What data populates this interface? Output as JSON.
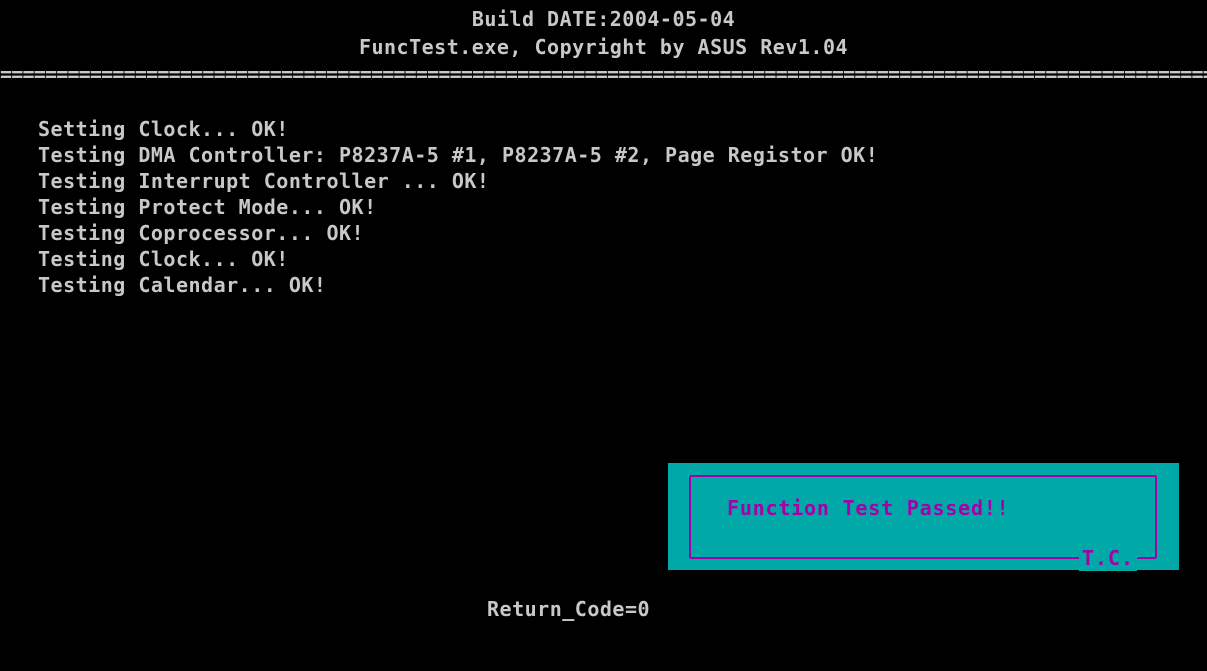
{
  "header": {
    "build_date": "Build DATE:2004-05-04",
    "copyright": "FuncTest.exe, Copyright by ASUS Rev1.04",
    "separator": "================================================================================================================"
  },
  "log": {
    "lines": [
      "Setting Clock... OK!",
      "Testing DMA Controller: P8237A-5 #1, P8237A-5 #2, Page Registor OK!",
      "Testing Interrupt Controller ... OK!",
      "Testing Protect Mode... OK!",
      "Testing Coprocessor... OK!",
      "Testing Clock... OK!",
      "Testing Calendar... OK!"
    ]
  },
  "dialog": {
    "message": "Function Test Passed!!",
    "tag": "T.C."
  },
  "footer": {
    "return_code": "Return_Code=0"
  },
  "colors": {
    "background": "#000000",
    "text": "#c8c8c8",
    "dialog_bg": "#00a8a8",
    "dialog_fg": "#a800a8"
  }
}
